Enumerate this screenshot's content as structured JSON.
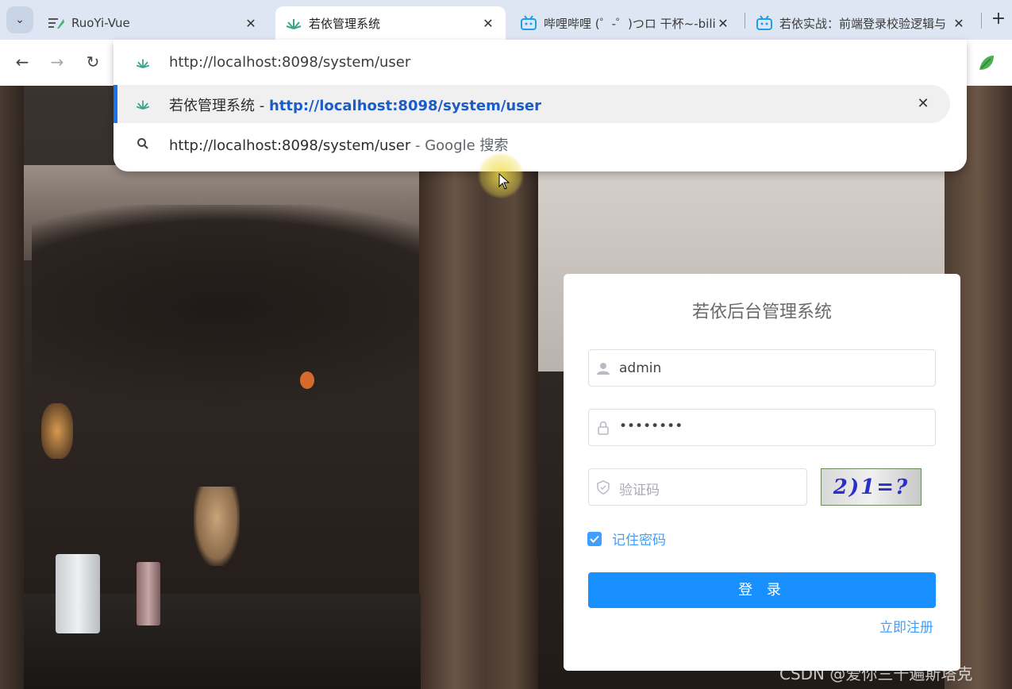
{
  "browser": {
    "tabs": [
      {
        "title": "RuoYi-Vue",
        "icon": "ruoyi-doc-icon"
      },
      {
        "title": "若依管理系统",
        "icon": "ruoyi-leaf-icon",
        "active": true
      },
      {
        "title": "哔哩哔哩 (゜-゜)つロ 干杯~-bili",
        "icon": "bilibili-icon"
      },
      {
        "title": "若依实战：前端登录校验逻辑与",
        "icon": "bilibili-icon"
      }
    ],
    "omnibox": {
      "input": "http://localhost:8098/system/user",
      "suggestion_1": {
        "title": "若依管理系统",
        "sep": " - ",
        "url": "http://localhost:8098/system/user"
      },
      "suggestion_2": {
        "query": "http://localhost:8098/system/user",
        "suffix": " - Google 搜索"
      }
    }
  },
  "login": {
    "title": "若依后台管理系统",
    "username": "admin",
    "password": "••••••••",
    "captcha_placeholder": "验证码",
    "captcha_text": "2)1=?",
    "remember": "记住密码",
    "login_button": "登 录",
    "register_link": "立即注册"
  },
  "watermark": "CSDN @爱你三千遍斯塔克",
  "colors": {
    "primary": "#1890ff",
    "link": "#409eff",
    "tabbar": "#dfe6f3"
  }
}
